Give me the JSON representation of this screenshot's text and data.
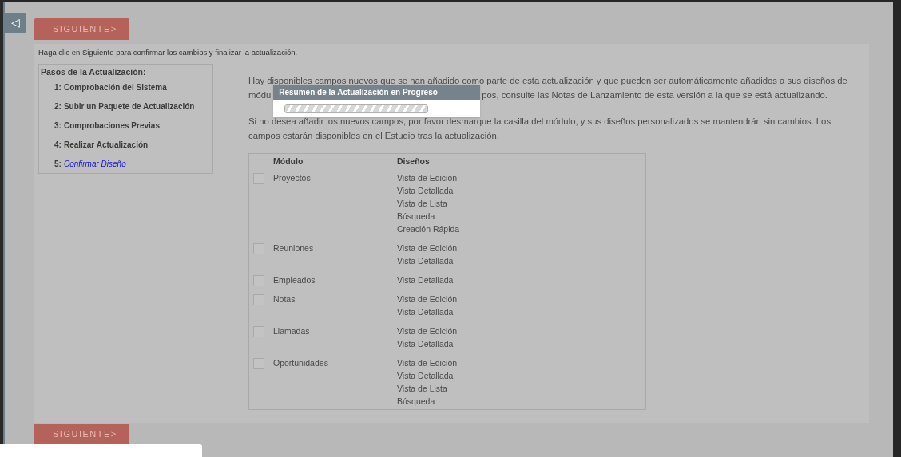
{
  "sidebar_toggle": "◁",
  "next_buttons": [
    "SIGUIENTE>",
    "SIGUIENTE>"
  ],
  "instruction": "Haga clic en Siguiente para confirmar los cambios y finalizar la actualización.",
  "steps": {
    "title": "Pasos de la Actualización:",
    "items": [
      {
        "label": "1: ",
        "name": "Comprobación del Sistema",
        "selected": false
      },
      {
        "label": "2: ",
        "name": "Subir un Paquete de Actualización",
        "selected": false
      },
      {
        "label": "3: ",
        "name": "Comprobaciones Previas",
        "selected": false
      },
      {
        "label": "4: ",
        "name": "Realizar Actualización",
        "selected": false
      },
      {
        "label": "5: ",
        "name": "Confirmar Diseño",
        "selected": true
      }
    ]
  },
  "intro_line_1": "Hay disponibles campos nuevos que se han añadido como parte de esta actualización y que pueden ser automáticamente añadidos a sus diseños de",
  "intro_line_2_start": "módu",
  "intro_line_2_end": "pos, consulte las Notas de Lanzamiento de esta versión a la que se está actualizando.",
  "note": "Si no desea añadir los nuevos campos, por favor desmarque la casilla del módulo, y sus diseños personalizados se mantendrán sin cambios. Los campos estarán disponibles en el Estudio tras la actualización.",
  "table": {
    "columns": [
      "Módulo",
      "Diseños"
    ],
    "rows": [
      {
        "module": "Proyectos",
        "checked": false,
        "layouts": [
          "Vista de Edición",
          "Vista Detallada",
          "Vista de Lista",
          "Búsqueda",
          "Creación Rápida"
        ]
      },
      {
        "module": "Reuniones",
        "checked": false,
        "layouts": [
          "Vista de Edición",
          "Vista Detallada"
        ]
      },
      {
        "module": "Empleados",
        "checked": false,
        "layouts": [
          "Vista Detallada"
        ]
      },
      {
        "module": "Notas",
        "checked": false,
        "layouts": [
          "Vista de Edición",
          "Vista Detallada"
        ]
      },
      {
        "module": "Llamadas",
        "checked": false,
        "layouts": [
          "Vista de Edición",
          "Vista Detallada"
        ]
      },
      {
        "module": "Oportunidades",
        "checked": false,
        "layouts": [
          "Vista de Edición",
          "Vista Detallada",
          "Vista de Lista",
          "Búsqueda"
        ]
      }
    ]
  },
  "dialog": {
    "title": "Resumen de la Actualización en Progreso",
    "progress": {
      "level": 1
    }
  }
}
